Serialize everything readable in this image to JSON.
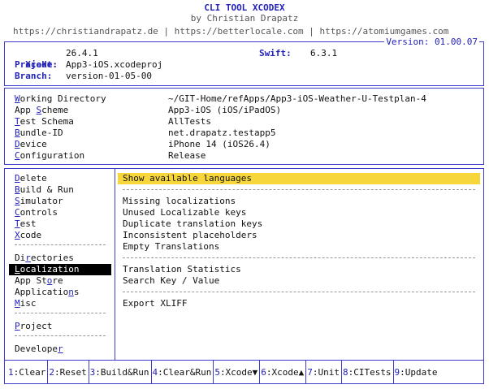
{
  "header": {
    "title": "CLI TOOL XCODEX",
    "subtitle": "by Christian Drapatz",
    "links": "https://christiandrapatz.de | https://betterlocale.com | https://atomiumgames.com",
    "version": "Version: 01.00.07"
  },
  "env": {
    "xcode_label": "Xcode:",
    "xcode_value": "26.4.1",
    "swift_label": "Swift:",
    "swift_value": "6.3.1",
    "projekt_label": "Projekt:",
    "projekt_value": "App3-iOS.xcodeproj",
    "branch_label": "Branch:",
    "branch_value": "version-01-05-00"
  },
  "settings": [
    {
      "hot": "W",
      "rest": "orking Directory",
      "value": "~/GIT-Home/refApps/App3-iOS-Weather-U-Testplan-4"
    },
    {
      "pre": "App ",
      "hot": "S",
      "rest": "cheme",
      "value": "App3-iOS (iOS/iPadOS)"
    },
    {
      "hot": "T",
      "rest": "est Schema",
      "value": "AllTests"
    },
    {
      "hot": "B",
      "rest": "undle-ID",
      "value": "net.drapatz.testapp5"
    },
    {
      "hot": "D",
      "rest": "evice",
      "value": "iPhone 14 (iOS26.4)"
    },
    {
      "hot": "C",
      "rest": "onfiguration",
      "value": "Release"
    }
  ],
  "menu": {
    "group1": [
      {
        "hot": "D",
        "rest": "elete"
      },
      {
        "hot": "B",
        "rest": "uild & Run"
      },
      {
        "hot": "S",
        "rest": "imulator"
      },
      {
        "hot": "C",
        "rest": "ontrols"
      },
      {
        "hot": "T",
        "rest": "est"
      },
      {
        "hot": "X",
        "rest": "code"
      }
    ],
    "group2": [
      {
        "pre": "Di",
        "hot": "r",
        "rest": "ectories"
      },
      {
        "hot": "L",
        "rest": "ocalization"
      },
      {
        "pre": "App St",
        "hot": "o",
        "rest": "re"
      },
      {
        "pre": "Applicatio",
        "hot": "n",
        "rest": "s"
      },
      {
        "hot": "M",
        "rest": "isc"
      }
    ],
    "group3": [
      {
        "hot": "P",
        "rest": "roject"
      }
    ],
    "group4": [
      {
        "pre": "Develope",
        "hot": "r",
        "rest": ""
      }
    ]
  },
  "actions": {
    "highlight": "Show available languages",
    "group1": [
      "Missing localizations",
      "Unused Localizable keys",
      "Duplicate translation keys",
      "Inconsistent placeholders",
      "Empty Translations"
    ],
    "group2": [
      "Translation Statistics",
      "Search Key / Value"
    ],
    "group3": [
      "Export XLIFF"
    ]
  },
  "footer": [
    {
      "num": "1",
      "label": ":Clear"
    },
    {
      "num": "2",
      "label": ":Reset"
    },
    {
      "num": "3",
      "label": ":Build&Run"
    },
    {
      "num": "4",
      "label": ":Clear&Run"
    },
    {
      "num": "5",
      "label": ":Xcode▼"
    },
    {
      "num": "6",
      "label": ":Xcode▲"
    },
    {
      "num": "7",
      "label": ":Unit"
    },
    {
      "num": "8",
      "label": ":CITests"
    },
    {
      "num": "9",
      "label": ":Update"
    }
  ]
}
